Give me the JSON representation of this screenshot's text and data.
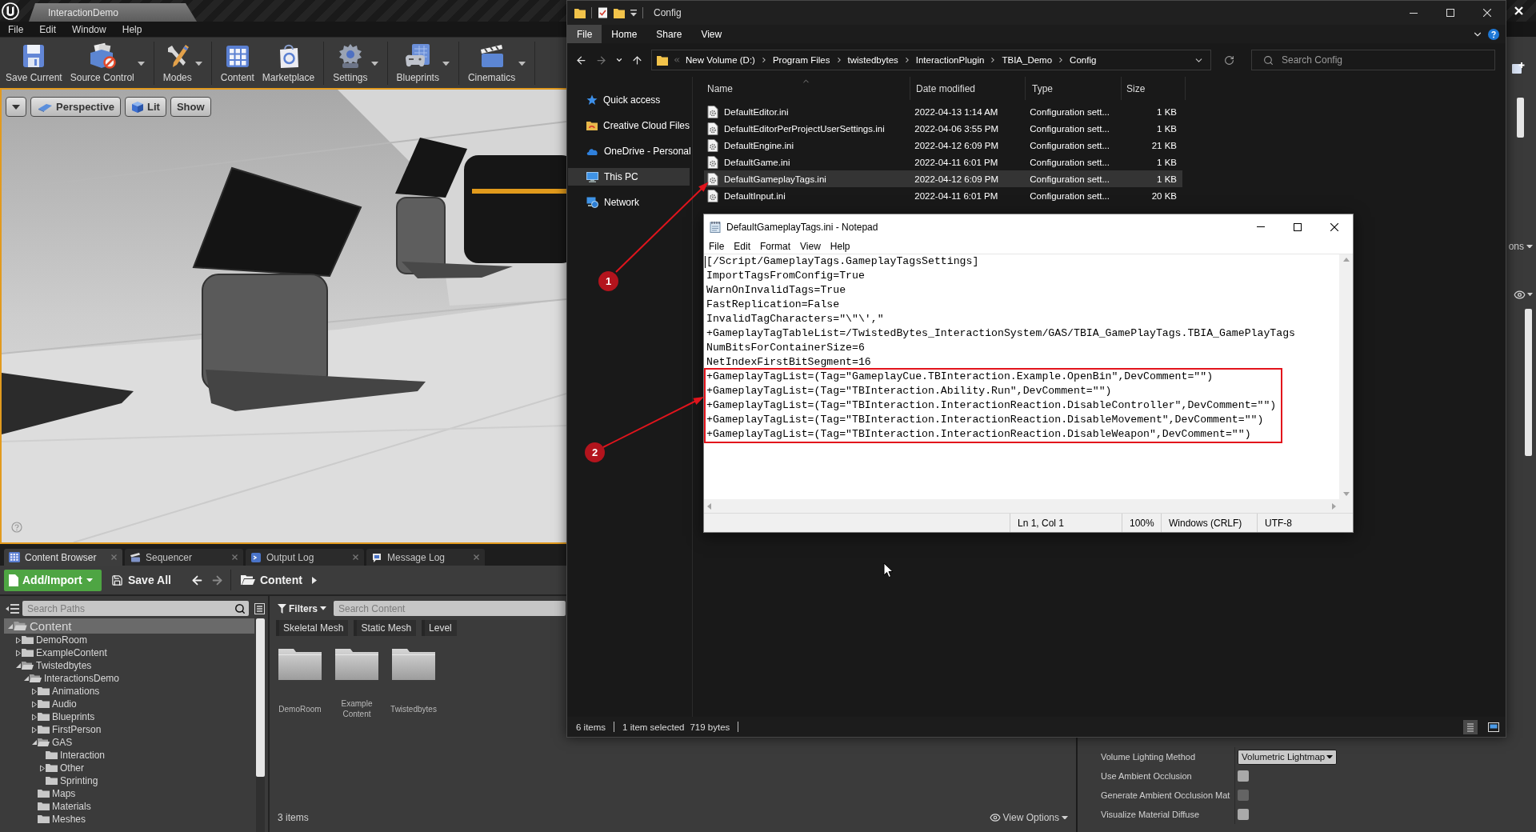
{
  "editor": {
    "tab_title": "InteractionDemo",
    "menu": [
      "File",
      "Edit",
      "Window",
      "Help"
    ],
    "toolbar_groups": [
      {
        "buttons": [
          {
            "label": "Save Current",
            "kind": "save",
            "dropdown": false
          },
          {
            "label": "Source Control",
            "kind": "source-control",
            "dropdown": true
          }
        ]
      },
      {
        "buttons": [
          {
            "label": "Modes",
            "kind": "modes",
            "dropdown": true
          }
        ]
      },
      {
        "buttons": [
          {
            "label": "Content",
            "kind": "content",
            "dropdown": false
          },
          {
            "label": "Marketplace",
            "kind": "marketplace",
            "dropdown": false
          }
        ]
      },
      {
        "buttons": [
          {
            "label": "Settings",
            "kind": "settings",
            "dropdown": true
          }
        ]
      },
      {
        "buttons": [
          {
            "label": "Blueprints",
            "kind": "blueprints",
            "dropdown": true
          }
        ]
      },
      {
        "buttons": [
          {
            "label": "Cinematics",
            "kind": "cinematics",
            "dropdown": true
          }
        ]
      }
    ]
  },
  "viewport": {
    "buttons": [
      {
        "label": "Perspective",
        "kind": "perspective"
      },
      {
        "label": "Lit",
        "kind": "lit"
      },
      {
        "label": "Show",
        "kind": "plain"
      }
    ]
  },
  "content_browser": {
    "tabs": [
      {
        "label": "Content Browser",
        "kind": "content-browser",
        "selected": true
      },
      {
        "label": "Sequencer",
        "kind": "sequencer",
        "selected": false
      },
      {
        "label": "Output Log",
        "kind": "output-log",
        "selected": false
      },
      {
        "label": "Message Log",
        "kind": "message-log",
        "selected": false
      }
    ],
    "add_button": "Add/Import",
    "save_button": "Save All",
    "path": "Content",
    "path_search": {
      "placeholder": "Search Paths"
    },
    "tree": [
      {
        "label": "Content",
        "kind": "branch",
        "expanded": true,
        "selected": true,
        "children": [
          {
            "label": "DemoRoom",
            "kind": "branch",
            "expanded": false,
            "selected": false
          },
          {
            "label": "ExampleContent",
            "kind": "branch",
            "expanded": false,
            "selected": false
          },
          {
            "label": "Twistedbytes",
            "kind": "branch",
            "expanded": true,
            "selected": false,
            "children": [
              {
                "label": "InteractionsDemo",
                "kind": "branch",
                "expanded": true,
                "selected": false,
                "children": [
                  {
                    "label": "Animations",
                    "kind": "branch",
                    "expanded": false,
                    "selected": false
                  },
                  {
                    "label": "Audio",
                    "kind": "branch",
                    "expanded": false,
                    "selected": false
                  },
                  {
                    "label": "Blueprints",
                    "kind": "branch",
                    "expanded": false,
                    "selected": false
                  },
                  {
                    "label": "FirstPerson",
                    "kind": "branch",
                    "expanded": false,
                    "selected": false
                  },
                  {
                    "label": "GAS",
                    "kind": "branch",
                    "expanded": true,
                    "selected": false,
                    "children": [
                      {
                        "label": "Interaction",
                        "kind": "leaf",
                        "expanded": false,
                        "selected": false
                      },
                      {
                        "label": "Other",
                        "kind": "branch",
                        "expanded": false,
                        "selected": false
                      },
                      {
                        "label": "Sprinting",
                        "kind": "leaf",
                        "expanded": false,
                        "selected": false
                      }
                    ]
                  },
                  {
                    "label": "Maps",
                    "kind": "leaf",
                    "expanded": false,
                    "selected": false
                  },
                  {
                    "label": "Materials",
                    "kind": "leaf",
                    "expanded": false,
                    "selected": false
                  },
                  {
                    "label": "Meshes",
                    "kind": "leaf",
                    "expanded": false,
                    "selected": false
                  }
                ]
              }
            ]
          }
        ]
      }
    ],
    "filters_button": "Filters",
    "content_search": {
      "placeholder": "Search Content"
    },
    "filter_chips": [
      "Skeletal Mesh",
      "Static Mesh",
      "Level"
    ],
    "folders": [
      "DemoRoom",
      "Example Content",
      "Twistedbytes"
    ],
    "item_count": "3 items",
    "view_options": "View Options"
  },
  "outliner": {
    "view_options": "ons"
  },
  "details": {
    "rows": [
      {
        "label": "Volume Lighting Method",
        "kind": "dropdown",
        "value": "Volumetric Lightmap"
      },
      {
        "label": "Use Ambient Occlusion",
        "kind": "checkbox",
        "checked": false,
        "disabled": false
      },
      {
        "label": "Generate Ambient Occlusion Mat",
        "kind": "checkbox",
        "checked": false,
        "disabled": true
      },
      {
        "label": "Visualize Material Diffuse",
        "kind": "checkbox",
        "checked": false,
        "disabled": false
      }
    ]
  },
  "explorer": {
    "title": "Config",
    "ribbon_tabs": [
      {
        "label": "File",
        "kind": "file-menu"
      },
      {
        "label": "Home",
        "kind": "tab"
      },
      {
        "label": "Share",
        "kind": "tab"
      },
      {
        "label": "View",
        "kind": "tab"
      }
    ],
    "breadcrumb": [
      "New Volume (D:)",
      "Program Files",
      "twistedbytes",
      "InteractionPlugin",
      "TBIA_Demo",
      "Config"
    ],
    "search": {
      "placeholder": "Search Config"
    },
    "nav": [
      {
        "label": "Quick access",
        "kind": "quick-access",
        "selected": false
      },
      {
        "label": "Creative Cloud Files",
        "kind": "creative-cloud",
        "selected": false
      },
      {
        "label": "OneDrive - Personal",
        "kind": "onedrive",
        "selected": false
      },
      {
        "label": "This PC",
        "kind": "this-pc",
        "selected": true
      },
      {
        "label": "Network",
        "kind": "network",
        "selected": false
      }
    ],
    "columns": [
      "Name",
      "Date modified",
      "Type",
      "Size"
    ],
    "files": [
      {
        "name": "DefaultEditor.ini",
        "date": "2022-04-13 1:14 AM",
        "type": "Configuration sett...",
        "size": "1 KB",
        "selected": false
      },
      {
        "name": "DefaultEditorPerProjectUserSettings.ini",
        "date": "2022-04-06 3:55 PM",
        "type": "Configuration sett...",
        "size": "1 KB",
        "selected": false
      },
      {
        "name": "DefaultEngine.ini",
        "date": "2022-04-12 6:09 PM",
        "type": "Configuration sett...",
        "size": "21 KB",
        "selected": false
      },
      {
        "name": "DefaultGame.ini",
        "date": "2022-04-11 6:01 PM",
        "type": "Configuration sett...",
        "size": "1 KB",
        "selected": false
      },
      {
        "name": "DefaultGameplayTags.ini",
        "date": "2022-04-12 6:09 PM",
        "type": "Configuration sett...",
        "size": "1 KB",
        "selected": true
      },
      {
        "name": "DefaultInput.ini",
        "date": "2022-04-11 6:01 PM",
        "type": "Configuration sett...",
        "size": "20 KB",
        "selected": false
      }
    ],
    "status": {
      "count": "6 items",
      "selection": "1 item selected",
      "size": "719 bytes"
    }
  },
  "notepad": {
    "title": "DefaultGameplayTags.ini - Notepad",
    "menu": [
      "File",
      "Edit",
      "Format",
      "View",
      "Help"
    ],
    "lines": [
      {
        "text": "[/Script/GameplayTags.GameplayTagsSettings]",
        "highlighted": false
      },
      {
        "text": "ImportTagsFromConfig=True",
        "highlighted": false
      },
      {
        "text": "WarnOnInvalidTags=True",
        "highlighted": false
      },
      {
        "text": "FastReplication=False",
        "highlighted": false
      },
      {
        "text": "InvalidTagCharacters=\"\\\"\\',\"",
        "highlighted": false
      },
      {
        "text": "+GameplayTagTableList=/TwistedBytes_InteractionSystem/GAS/TBIA_GamePlayTags.TBIA_GamePlayTags",
        "highlighted": false
      },
      {
        "text": "NumBitsForContainerSize=6",
        "highlighted": false
      },
      {
        "text": "NetIndexFirstBitSegment=16",
        "highlighted": false
      },
      {
        "text": "+GameplayTagList=(Tag=\"GameplayCue.TBInteraction.Example.OpenBin\",DevComment=\"\")",
        "highlighted": true
      },
      {
        "text": "+GameplayTagList=(Tag=\"TBInteraction.Ability.Run\",DevComment=\"\")",
        "highlighted": true
      },
      {
        "text": "+GameplayTagList=(Tag=\"TBInteraction.InteractionReaction.DisableController\",DevComment=\"\")",
        "highlighted": true
      },
      {
        "text": "+GameplayTagList=(Tag=\"TBInteraction.InteractionReaction.DisableMovement\",DevComment=\"\")",
        "highlighted": true
      },
      {
        "text": "+GameplayTagList=(Tag=\"TBInteraction.InteractionReaction.DisableWeapon\",DevComment=\"\")",
        "highlighted": true
      }
    ],
    "status": {
      "position": "Ln 1, Col 1",
      "zoom": "100%",
      "line_endings": "Windows (CRLF)",
      "encoding": "UTF-8"
    }
  },
  "annotations": [
    {
      "label": "1"
    },
    {
      "label": "2"
    }
  ]
}
